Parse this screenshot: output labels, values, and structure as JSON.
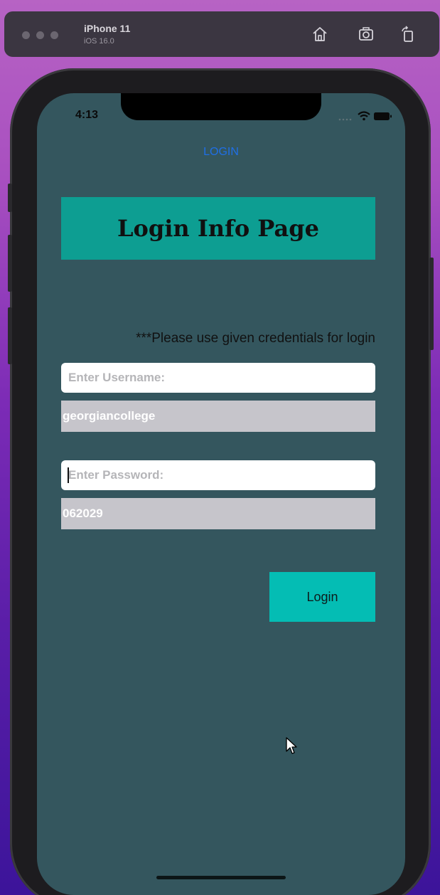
{
  "simulator": {
    "device_name": "iPhone 11",
    "os_version": "iOS 16.0",
    "icons": [
      "home-icon",
      "screenshot-icon",
      "rotate-icon"
    ]
  },
  "status_bar": {
    "time": "4:13",
    "icons": [
      "signal-dots-icon",
      "wifi-icon",
      "battery-icon"
    ]
  },
  "nav": {
    "title": "LOGIN"
  },
  "page": {
    "title": "Login Info Page",
    "hint": "***Please use given credentials for login"
  },
  "username": {
    "placeholder": "Enter Username:",
    "value": "",
    "given": "georgiancollege"
  },
  "password": {
    "placeholder": "Enter Password:",
    "value": "",
    "given": "062029"
  },
  "login_button": {
    "label": "Login"
  },
  "colors": {
    "screen_bg": "#34565e",
    "title_bg": "#0d9e92",
    "button_bg": "#04bdb4",
    "nav_title": "#1f6fe6",
    "credential_bg": "#c6c5cb"
  }
}
